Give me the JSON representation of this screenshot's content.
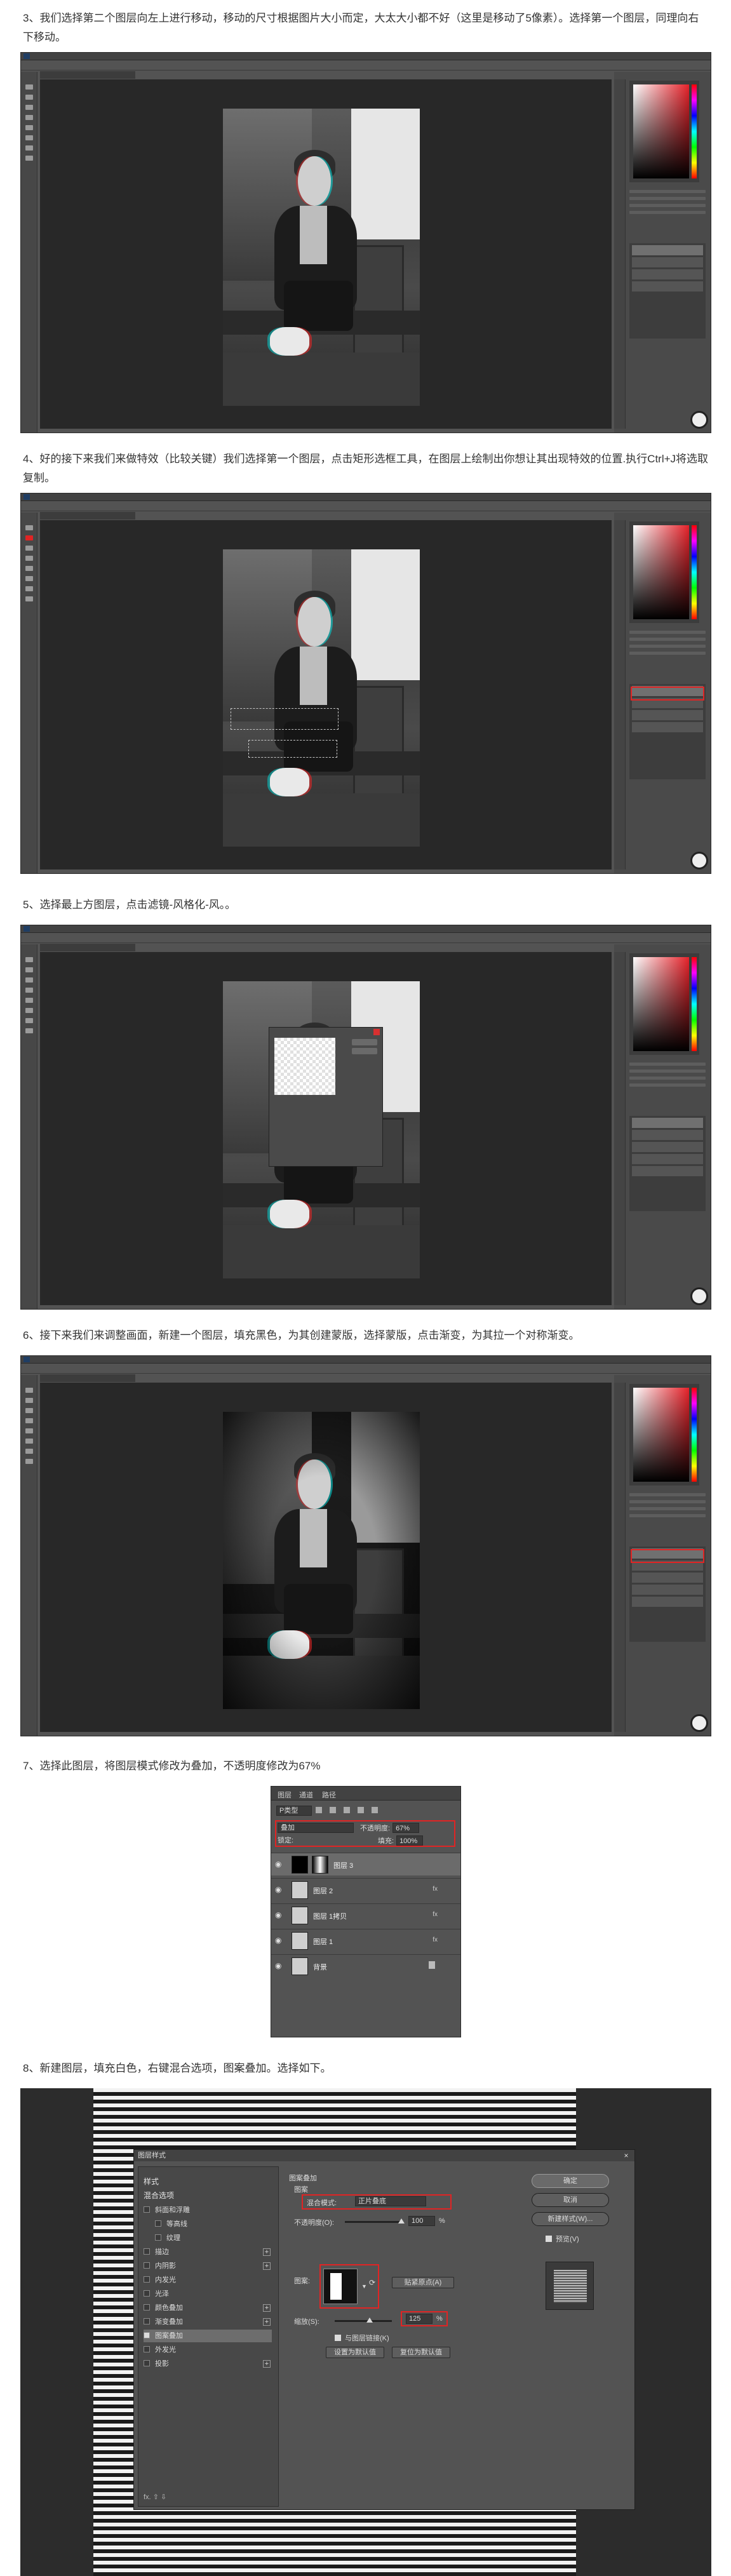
{
  "steps": {
    "s3": "3、我们选择第二个图层向左上进行移动，移动的尺寸根据图片大小而定，大太大小都不好（这里是移动了5像素）。选择第一个图层，同理向右下移动。",
    "s4": "4、好的接下来我们来做特效（比较关键）我们选择第一个图层，点击矩形选框工具，在图层上绘制出你想让其出现特效的位置.执行Ctrl+J将选取复制。",
    "s5": "5、选择最上方图层，点击滤镜-风格化-风。。",
    "s6": "6、接下来我们来调整画面，新建一个图层，填充黑色，为其创建蒙版，选择蒙版，点击渐变，为其拉一个对称渐变。",
    "s7": "7、选择此图层，将图层模式修改为叠加，不透明度修改为67%",
    "s8": "8、新建图层，填充白色，右键混合选项，图案叠加。选择如下。"
  },
  "layers_panel": {
    "tabs": [
      "图层",
      "通道",
      "路径"
    ],
    "kind_label": "P类型",
    "blend_mode": "叠加",
    "opacity_label": "不透明度:",
    "opacity_value": "67%",
    "lock_label": "锁定:",
    "fill_label": "填充:",
    "fill_value": "100%",
    "layers": [
      {
        "name": "图层 3",
        "selected": true,
        "has_mask": true
      },
      {
        "name": "图层 2",
        "fx": "fx"
      },
      {
        "name": "图层 1拷贝",
        "fx": "fx"
      },
      {
        "name": "图层 1",
        "fx": "fx"
      },
      {
        "name": "背景",
        "locked": true
      }
    ]
  },
  "layer_style": {
    "title": "图层样式",
    "close": "×",
    "styles_header": "样式",
    "blend_options": "混合选项",
    "items": [
      {
        "label": "斜面和浮雕",
        "checked": false
      },
      {
        "label": "等高线",
        "checked": false
      },
      {
        "label": "纹理",
        "checked": false
      },
      {
        "label": "描边",
        "checked": false,
        "plus": true
      },
      {
        "label": "内阴影",
        "checked": false,
        "plus": true
      },
      {
        "label": "内发光",
        "checked": false
      },
      {
        "label": "光泽",
        "checked": false
      },
      {
        "label": "颜色叠加",
        "checked": false,
        "plus": true
      },
      {
        "label": "渐变叠加",
        "checked": false,
        "plus": true
      },
      {
        "label": "图案叠加",
        "checked": true,
        "selected": true
      },
      {
        "label": "外发光",
        "checked": false
      },
      {
        "label": "投影",
        "checked": false,
        "plus": true
      }
    ],
    "fx_bar": "fx. ⇧ ⇩",
    "section_title": "图案叠加",
    "section_sub": "图案",
    "blend_mode_label": "混合模式:",
    "blend_mode_value": "正片叠底",
    "opacity_label": "不透明度(O):",
    "opacity_value": "100",
    "percent": "%",
    "pattern_label": "图案:",
    "snap_button": "贴紧原点(A)",
    "scale_label": "缩放(S):",
    "scale_value": "125",
    "link_layer": "与图层链接(K)",
    "set_default": "设置为默认值",
    "reset_default": "复位为默认值",
    "ok": "确定",
    "cancel": "取消",
    "new_style": "新建样式(W)...",
    "preview": "预览(V)"
  }
}
